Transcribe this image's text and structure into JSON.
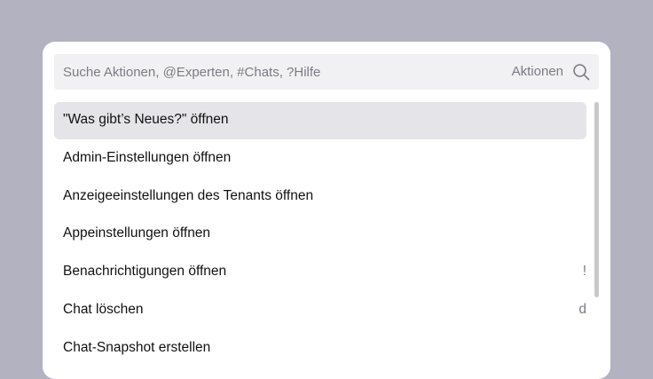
{
  "search": {
    "placeholder": "Suche Aktionen, @Experten, #Chats, ?Hilfe",
    "scope_label": "Aktionen",
    "icon": "search-icon"
  },
  "actions": [
    {
      "label": "\"Was gibt’s Neues?\" öffnen",
      "shortcut": "",
      "active": true
    },
    {
      "label": "Admin-Einstellungen öffnen",
      "shortcut": ""
    },
    {
      "label": "Anzeigeeinstellungen des Tenants öffnen",
      "shortcut": ""
    },
    {
      "label": "Appeinstellungen öffnen",
      "shortcut": ""
    },
    {
      "label": "Benachrichtigungen öffnen",
      "shortcut": "!"
    },
    {
      "label": "Chat löschen",
      "shortcut": "d"
    },
    {
      "label": "Chat-Snapshot erstellen",
      "shortcut": ""
    }
  ],
  "colors": {
    "backdrop": "#b3b2c0",
    "panel": "#ffffff",
    "search_bg": "#f1f1f3",
    "active_item_bg": "#e5e5e9",
    "muted_text": "#7b7b85"
  }
}
